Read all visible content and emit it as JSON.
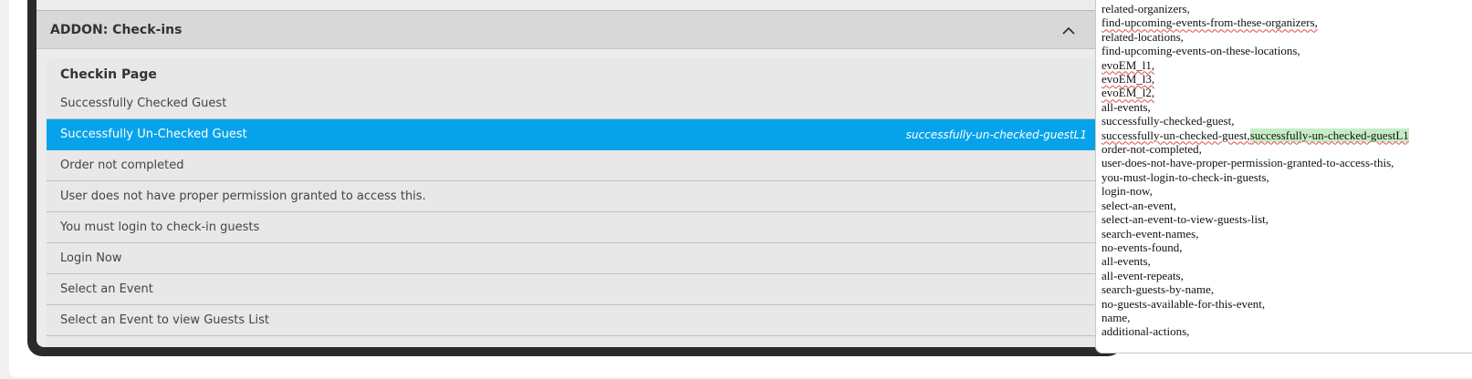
{
  "addon": {
    "title": "ADDON: Check-ins",
    "section_title": "Checkin Page",
    "rows": [
      {
        "label": "Successfully Checked Guest",
        "value": ""
      },
      {
        "label": "Successfully Un-Checked Guest",
        "value": "successfully-un-checked-guestL1"
      },
      {
        "label": "Order not completed",
        "value": ""
      },
      {
        "label": "User does not have proper permission granted to access this.",
        "value": ""
      },
      {
        "label": "You must login to check-in guests",
        "value": ""
      },
      {
        "label": "Login Now",
        "value": ""
      },
      {
        "label": "Select an Event",
        "value": ""
      },
      {
        "label": "Select an Event to view Guests List",
        "value": ""
      }
    ]
  },
  "textarea": {
    "lines": [
      "related-organizers,",
      "find-upcoming-events-from-these-organizers,",
      "related-locations,",
      "find-upcoming-events-on-these-locations,",
      "evoEM_l1,",
      "evoEM_l3,",
      "evoEM_l2,",
      "all-events,",
      "successfully-checked-guest,",
      "successfully-un-checked-guest,",
      "order-not-completed,",
      "user-does-not-have-proper-permission-granted-to-access-this,",
      "you-must-login-to-check-in-guests,",
      "login-now,",
      "select-an-event,",
      "select-an-event-to-view-guests-list,",
      "search-event-names,",
      "no-events-found,",
      "all-events,",
      "all-event-repeats,",
      "search-guests-by-name,",
      "no-guests-available-for-this-event,",
      "name,",
      "additional-actions,"
    ],
    "highlight": "successfully-un-checked-guestL1"
  },
  "colors": {
    "active_row": "#07a3ea",
    "highlight": "#c6ecc5"
  }
}
